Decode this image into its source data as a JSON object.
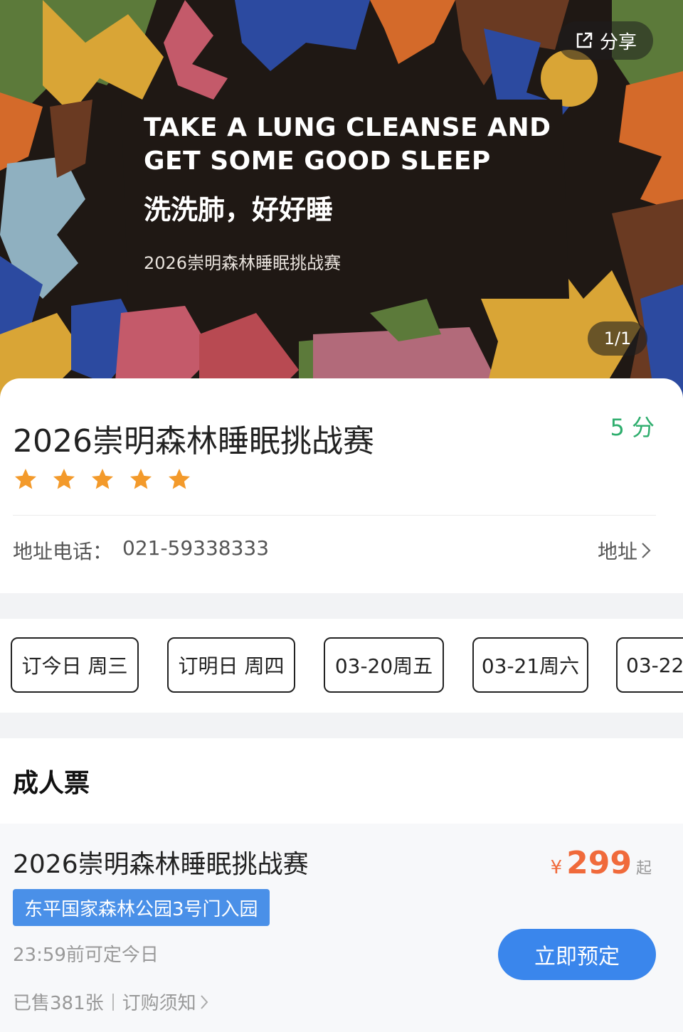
{
  "banner": {
    "share_label": "分享",
    "headline_line1": "TAKE A LUNG CLEANSE AND",
    "headline_line2": "GET SOME GOOD SLEEP",
    "headline_cn": "洗洗肺，好好睡",
    "subtitle": "2026崇明森林睡眠挑战赛",
    "counter": "1/1"
  },
  "info": {
    "title": "2026崇明森林睡眠挑战赛",
    "score": "5 分",
    "rating": 5,
    "rating_max": 5,
    "address_label": "地址电话：",
    "phone": "021-59338333",
    "address_link": "地址"
  },
  "dates": [
    {
      "label": "订今日 周三"
    },
    {
      "label": "订明日 周四"
    },
    {
      "label": "03-20周五"
    },
    {
      "label": "03-21周六"
    },
    {
      "label": "03-22"
    }
  ],
  "tickets": {
    "section_title": "成人票",
    "items": [
      {
        "name": "2026崇明森林睡眠挑战赛",
        "currency": "¥",
        "price": "299",
        "price_suffix": "起",
        "tag": "东平国家森林公园3号门入园",
        "deadline": "23:59前可定今日",
        "sold": "已售381张",
        "notice": "订购须知",
        "book_label": "立即预定"
      }
    ]
  },
  "colors": {
    "accent_green": "#2fae6e",
    "price_orange": "#f06a3b",
    "star_orange": "#f39a2b",
    "tag_blue": "#4a90e8",
    "button_blue": "#3a86ec"
  },
  "icons": [
    "share-icon",
    "star-icon",
    "chevron-right-icon"
  ]
}
